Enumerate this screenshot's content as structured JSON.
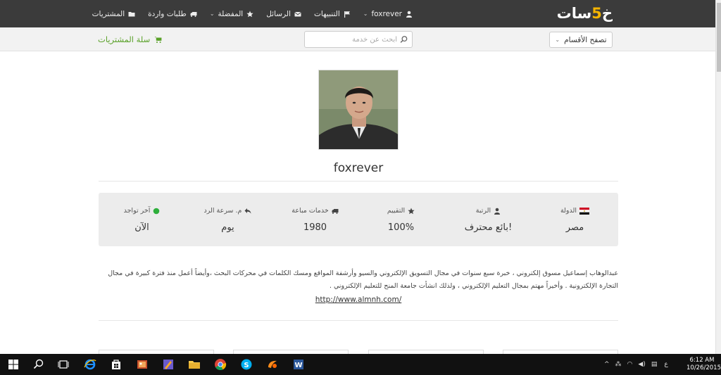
{
  "brand": {
    "logo_prefix": "خ",
    "logo_five": "5",
    "logo_suffix": "سات"
  },
  "nav": {
    "user": "foxrever",
    "notifications": "التنبيهات",
    "messages": "الرسائل",
    "favorites": "المفضلة",
    "incoming_orders": "طلبات واردة",
    "purchases": "المشتريات"
  },
  "subbar": {
    "browse": "تصفح الأقسام",
    "search_placeholder": "ابحث عن خدمة",
    "cart": "سلة المشتريات"
  },
  "profile": {
    "username": "foxrever",
    "stats": [
      {
        "label": "الدولة",
        "value": "مصر",
        "icon": "egypt-flag-icon"
      },
      {
        "label": "الرتبة",
        "value": "بائع محترف!",
        "icon": "user-icon"
      },
      {
        "label": "التقييم",
        "value": "100%",
        "icon": "star-icon"
      },
      {
        "label": "خدمات مباعة",
        "value": "1980",
        "icon": "truck-icon"
      },
      {
        "label": "م. سرعة الرد",
        "value": "يوم",
        "icon": "reply-icon"
      },
      {
        "label": "آخر تواجد",
        "value": "الآن",
        "icon": "online-dot-icon"
      }
    ],
    "bio": "عبدالوهاب إسماعيل مسوق إلكتروني ، خبرة سبع سنوات في مجال التسويق الإلكتروني والسيو وأرشفة المواقع ومسك الكلمات في محركات البحث ،وأيضاً أعمل منذ فترة كبيرة في مجال التجارة الإلكترونية . وأخيراً مهتم بمجال التعليم الإلكتروني ، ولذلك انشأت جامعة المنح للتعليم الإلكتروني .",
    "link": "http://www.almnh.com/"
  },
  "taskbar": {
    "time": "6:12 AM",
    "date": "10/26/2015",
    "lang": "ع"
  },
  "colors": {
    "topbar": "#3b3b3b",
    "accent_green": "#5aa129",
    "logo_gold": "#f4b400"
  }
}
